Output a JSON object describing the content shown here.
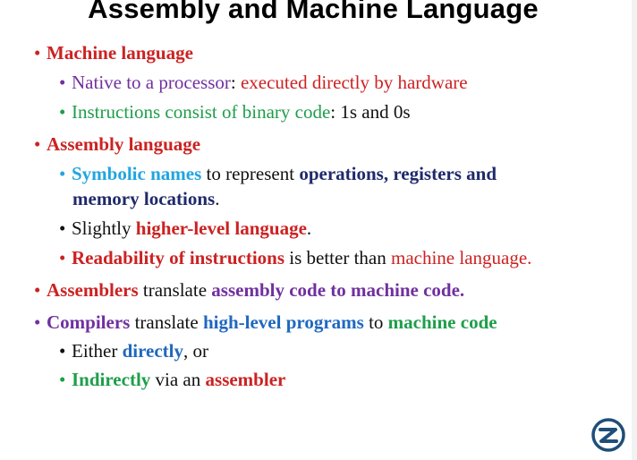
{
  "title": "Assembly and Machine Language",
  "bullet": "•",
  "logo": {
    "icon": "z-logo-icon",
    "color": "#1f4e79"
  },
  "items": [
    {
      "parts": [
        "Machine language"
      ]
    },
    {
      "parts": [
        "Native to a processor",
        ": ",
        "executed directly by hardware"
      ]
    },
    {
      "parts": [
        "Instructions consist of binary code",
        ": ",
        "1s and 0s"
      ]
    },
    {
      "parts": [
        "Assembly language"
      ]
    },
    {
      "parts": [
        "Symbolic names",
        " to represent ",
        "operations, registers and"
      ]
    },
    {
      "parts": [
        "memory locations",
        "."
      ]
    },
    {
      "parts": [
        "Slightly ",
        "higher-level language",
        "."
      ]
    },
    {
      "parts": [
        "Readability of instructions",
        " is better than ",
        "machine language."
      ]
    },
    {
      "parts": [
        "Assemblers",
        " translate ",
        "assembly code to machine code."
      ]
    },
    {
      "parts": [
        "Compilers",
        " translate ",
        "high-level programs",
        " to ",
        "machine code"
      ]
    },
    {
      "parts": [
        "Either ",
        "directly",
        ", or"
      ]
    },
    {
      "parts": [
        "Indirectly",
        " via an ",
        "assembler"
      ]
    }
  ]
}
